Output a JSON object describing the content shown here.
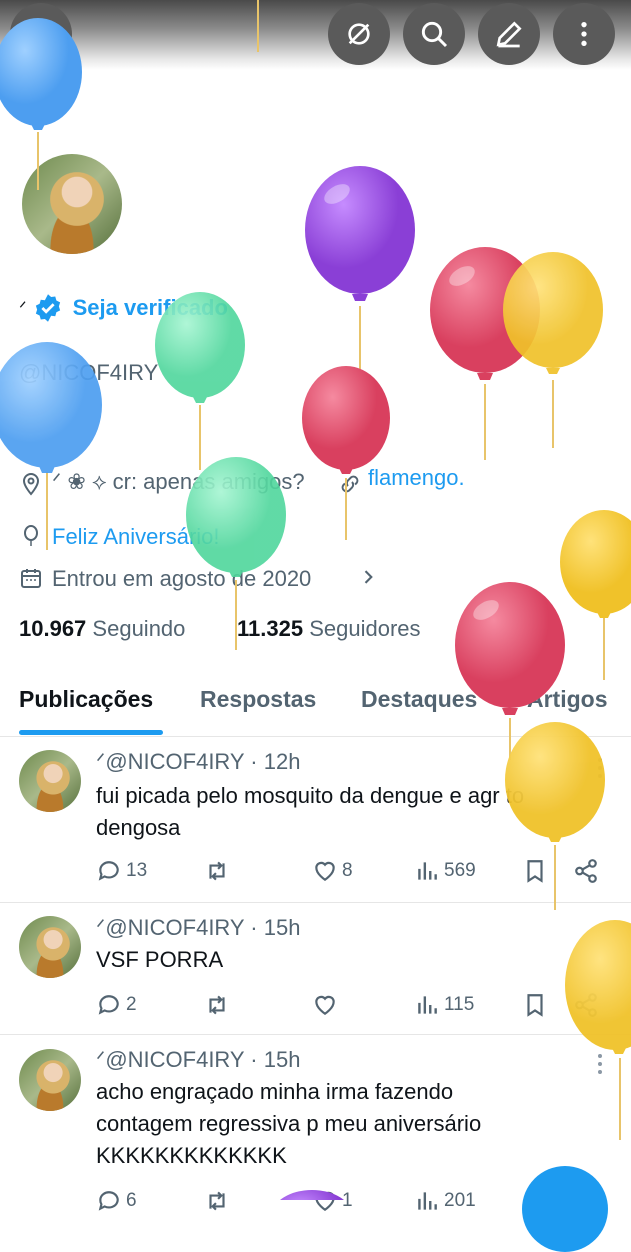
{
  "header": {
    "back_icon": "back-arrow-icon",
    "buttons": [
      "grok-icon",
      "search-icon",
      "compose-icon",
      "more-vertical-icon"
    ]
  },
  "profile": {
    "name_mark": "ᐟ",
    "verify_label": "Seja verificado",
    "handle": "@NICOF4IRY",
    "location": "ᐟ ❀ ⟡ cr: apenas amigos?",
    "link": "flamengo.",
    "birthday": "Feliz Aniversário!",
    "joined": "Entrou em agosto de 2020",
    "following_count": "10.967",
    "following_label": "Seguindo",
    "followers_count": "11.325",
    "followers_label": "Seguidores"
  },
  "tabs": [
    "Publicações",
    "Respostas",
    "Destaques",
    "Artigos"
  ],
  "posts": [
    {
      "head": "ᐟ@NICOF4IRY · 12h",
      "body": "fui picada pelo mosquito da dengue e agr to dengosa",
      "replies": "13",
      "reposts": "",
      "likes": "8",
      "views": "569"
    },
    {
      "head": "ᐟ@NICOF4IRY · 15h",
      "body": "VSF PORRA",
      "replies": "2",
      "reposts": "",
      "likes": "",
      "views": "115"
    },
    {
      "head": "ᐟ@NICOF4IRY · 15h",
      "body": "acho engraçado minha irma fazendo contagem regressiva p meu aniversário KKKKKKKKKKKKK",
      "replies": "6",
      "reposts": "",
      "likes": "1",
      "views": "201"
    }
  ],
  "colors": {
    "accent": "#1d9bf0",
    "text": "#0f1419",
    "muted": "#536471",
    "balloon_blue": "#5aa9f5",
    "balloon_purple": "#9b4fe0",
    "balloon_red": "#e24f6d",
    "balloon_yellow": "#f5cf3a",
    "balloon_green": "#5ddca7"
  }
}
